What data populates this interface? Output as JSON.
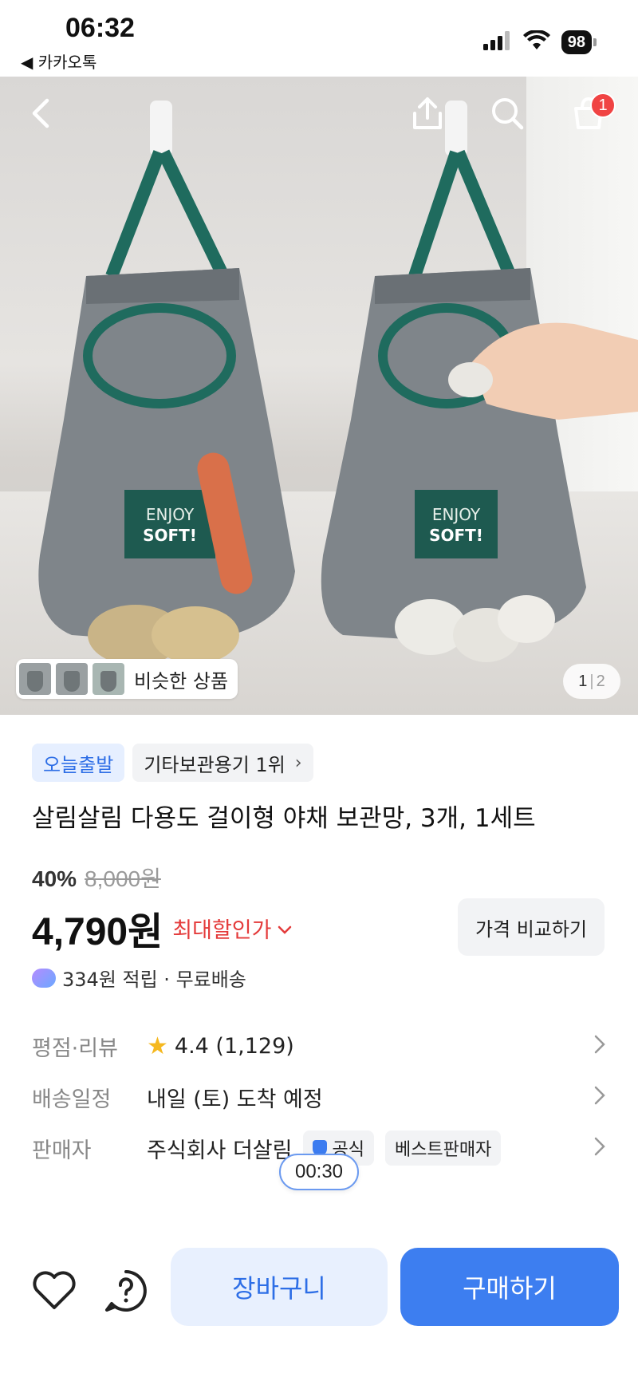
{
  "status_bar": {
    "time": "06:32",
    "back_app": "◀ 카카오톡",
    "battery": "98"
  },
  "hero": {
    "cart_count": "1",
    "similar_label": "비슷한 상품",
    "page_current": "1",
    "page_total": "2"
  },
  "tags": {
    "today_ship": "오늘출발",
    "ranking": "기타보관용기 1위"
  },
  "product": {
    "title": "살림살림 다용도 걸이형 야채 보관망, 3개, 1세트",
    "discount_pct": "40%",
    "original_price": "8,000원",
    "price": "4,790원",
    "max_discount_label": "최대할인가",
    "compare_label": "가격 비교하기",
    "points": "334원 적립 · 무료배송"
  },
  "info": {
    "rating_label": "평점·리뷰",
    "rating_value": "4.4 (1,129)",
    "shipping_label": "배송일정",
    "shipping_value": "내일 (토) 도착 예정",
    "seller_label": "판매자",
    "seller_value": "주식회사 더살림",
    "official_badge": "공식",
    "best_seller_badge": "베스트판매자"
  },
  "timer": "00:30",
  "bottom": {
    "cart_label": "장바구니",
    "buy_label": "구매하기"
  },
  "colors": {
    "accent_blue": "#3d7ef0",
    "sale_red": "#e43b3b",
    "badge_red": "#f04343"
  }
}
